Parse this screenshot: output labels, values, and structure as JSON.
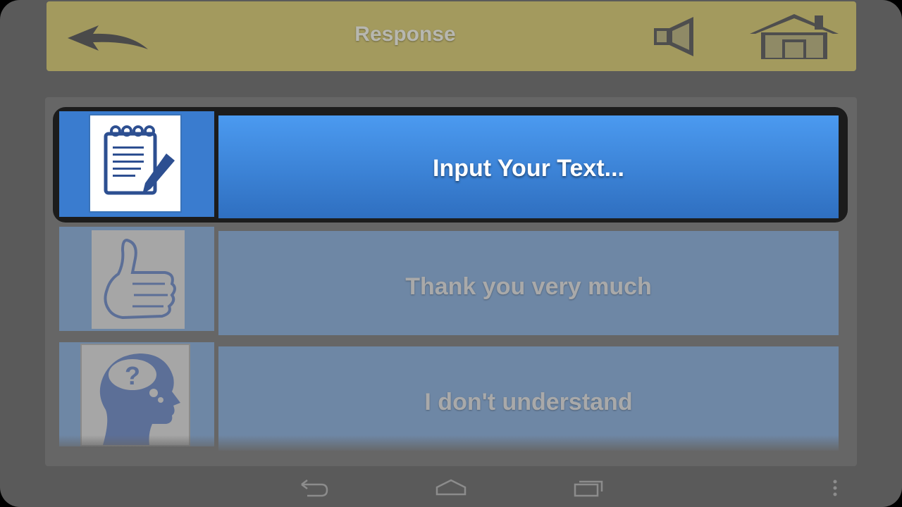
{
  "header": {
    "title": "Response",
    "back_icon": "back-arrow-icon",
    "speaker_icon": "speaker-icon",
    "home_icon": "home-icon",
    "background_color": "#a39a5e"
  },
  "responses": [
    {
      "label": "Input Your Text...",
      "icon": "notepad-pencil-icon",
      "selected": true
    },
    {
      "label": "Thank you very much",
      "icon": "thumbs-up-icon",
      "selected": false
    },
    {
      "label": "I don't understand",
      "icon": "head-question-icon",
      "selected": false
    }
  ],
  "navbar": {
    "back_icon": "nav-back-icon",
    "home_icon": "nav-home-icon",
    "recents_icon": "nav-recents-icon",
    "menu_icon": "overflow-menu-icon"
  },
  "colors": {
    "selected_row": "#3d86e0",
    "unselected_row": "#6e87a5",
    "panel": "#666666",
    "frame": "#5a5a5a"
  }
}
